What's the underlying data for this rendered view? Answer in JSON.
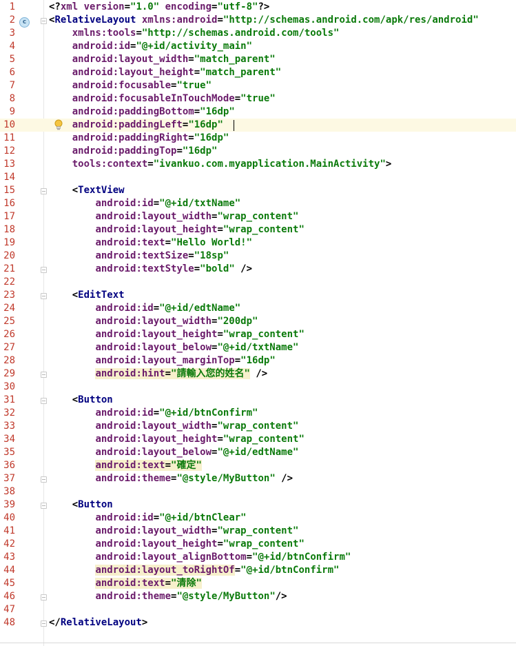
{
  "editor": {
    "current_line": 10,
    "lines": [
      {
        "n": "1",
        "segs": [
          [
            "punct",
            "<?"
          ],
          [
            "attr",
            "xml version"
          ],
          [
            "punct",
            "="
          ],
          [
            "val",
            "\"1.0\""
          ],
          [
            "attr",
            " encoding"
          ],
          [
            "punct",
            "="
          ],
          [
            "val",
            "\"utf-8\""
          ],
          [
            "punct",
            "?>"
          ]
        ]
      },
      {
        "n": "2",
        "segs": [
          [
            "punct",
            "<"
          ],
          [
            "tag",
            "RelativeLayout "
          ],
          [
            "attr",
            "xmlns:android"
          ],
          [
            "punct",
            "="
          ],
          [
            "val",
            "\"http://schemas.android.com/apk/res/android\""
          ]
        ]
      },
      {
        "n": "3",
        "segs": [
          [
            "punct",
            "    "
          ],
          [
            "attr",
            "xmlns:tools"
          ],
          [
            "punct",
            "="
          ],
          [
            "val",
            "\"http://schemas.android.com/tools\""
          ]
        ]
      },
      {
        "n": "4",
        "segs": [
          [
            "punct",
            "    "
          ],
          [
            "attr",
            "android:id"
          ],
          [
            "punct",
            "="
          ],
          [
            "val",
            "\"@+id/activity_main\""
          ]
        ]
      },
      {
        "n": "5",
        "segs": [
          [
            "punct",
            "    "
          ],
          [
            "attr",
            "android:layout_width"
          ],
          [
            "punct",
            "="
          ],
          [
            "val",
            "\"match_parent\""
          ]
        ]
      },
      {
        "n": "6",
        "segs": [
          [
            "punct",
            "    "
          ],
          [
            "attr",
            "android:layout_height"
          ],
          [
            "punct",
            "="
          ],
          [
            "val",
            "\"match_parent\""
          ]
        ]
      },
      {
        "n": "7",
        "segs": [
          [
            "punct",
            "    "
          ],
          [
            "attr",
            "android:focusable"
          ],
          [
            "punct",
            "="
          ],
          [
            "val",
            "\"true\""
          ]
        ]
      },
      {
        "n": "8",
        "segs": [
          [
            "punct",
            "    "
          ],
          [
            "attr",
            "android:focusableInTouchMode"
          ],
          [
            "punct",
            "="
          ],
          [
            "val",
            "\"true\""
          ]
        ]
      },
      {
        "n": "9",
        "segs": [
          [
            "punct",
            "    "
          ],
          [
            "attr",
            "android:paddingBottom"
          ],
          [
            "punct",
            "="
          ],
          [
            "val",
            "\"16dp\""
          ]
        ]
      },
      {
        "n": "10",
        "segs": [
          [
            "punct",
            "    "
          ],
          [
            "attr",
            "android:paddingLeft"
          ],
          [
            "punct",
            "="
          ],
          [
            "val",
            "\"16dp\""
          ]
        ]
      },
      {
        "n": "11",
        "segs": [
          [
            "punct",
            "    "
          ],
          [
            "attr",
            "android:paddingRight"
          ],
          [
            "punct",
            "="
          ],
          [
            "val",
            "\"16dp\""
          ]
        ]
      },
      {
        "n": "12",
        "segs": [
          [
            "punct",
            "    "
          ],
          [
            "attr",
            "android:paddingTop"
          ],
          [
            "punct",
            "="
          ],
          [
            "val",
            "\"16dp\""
          ]
        ]
      },
      {
        "n": "13",
        "segs": [
          [
            "punct",
            "    "
          ],
          [
            "attr",
            "tools:context"
          ],
          [
            "punct",
            "="
          ],
          [
            "val",
            "\"ivankuo.com.myapplication.MainActivity\""
          ],
          [
            "punct",
            ">"
          ]
        ]
      },
      {
        "n": "14",
        "segs": []
      },
      {
        "n": "15",
        "segs": [
          [
            "punct",
            "    <"
          ],
          [
            "tag",
            "TextView"
          ]
        ]
      },
      {
        "n": "16",
        "segs": [
          [
            "punct",
            "        "
          ],
          [
            "attr",
            "android:id"
          ],
          [
            "punct",
            "="
          ],
          [
            "val",
            "\"@+id/txtName\""
          ]
        ]
      },
      {
        "n": "17",
        "segs": [
          [
            "punct",
            "        "
          ],
          [
            "attr",
            "android:layout_width"
          ],
          [
            "punct",
            "="
          ],
          [
            "val",
            "\"wrap_content\""
          ]
        ]
      },
      {
        "n": "18",
        "segs": [
          [
            "punct",
            "        "
          ],
          [
            "attr",
            "android:layout_height"
          ],
          [
            "punct",
            "="
          ],
          [
            "val",
            "\"wrap_content\""
          ]
        ]
      },
      {
        "n": "19",
        "segs": [
          [
            "punct",
            "        "
          ],
          [
            "attr",
            "android:text"
          ],
          [
            "punct",
            "="
          ],
          [
            "val",
            "\"Hello World!\""
          ]
        ]
      },
      {
        "n": "20",
        "segs": [
          [
            "punct",
            "        "
          ],
          [
            "attr",
            "android:textSize"
          ],
          [
            "punct",
            "="
          ],
          [
            "val",
            "\"18sp\""
          ]
        ]
      },
      {
        "n": "21",
        "segs": [
          [
            "punct",
            "        "
          ],
          [
            "attr",
            "android:textStyle"
          ],
          [
            "punct",
            "="
          ],
          [
            "val",
            "\"bold\""
          ],
          [
            "punct",
            " />"
          ]
        ]
      },
      {
        "n": "22",
        "segs": []
      },
      {
        "n": "23",
        "segs": [
          [
            "punct",
            "    <"
          ],
          [
            "tag",
            "EditText"
          ]
        ]
      },
      {
        "n": "24",
        "segs": [
          [
            "punct",
            "        "
          ],
          [
            "attr",
            "android:id"
          ],
          [
            "punct",
            "="
          ],
          [
            "val",
            "\"@+id/edtName\""
          ]
        ]
      },
      {
        "n": "25",
        "segs": [
          [
            "punct",
            "        "
          ],
          [
            "attr",
            "android:layout_width"
          ],
          [
            "punct",
            "="
          ],
          [
            "val",
            "\"200dp\""
          ]
        ]
      },
      {
        "n": "26",
        "segs": [
          [
            "punct",
            "        "
          ],
          [
            "attr",
            "android:layout_height"
          ],
          [
            "punct",
            "="
          ],
          [
            "val",
            "\"wrap_content\""
          ]
        ]
      },
      {
        "n": "27",
        "segs": [
          [
            "punct",
            "        "
          ],
          [
            "attr",
            "android:layout_below"
          ],
          [
            "punct",
            "="
          ],
          [
            "val",
            "\"@+id/txtName\""
          ]
        ]
      },
      {
        "n": "28",
        "segs": [
          [
            "punct",
            "        "
          ],
          [
            "attr",
            "android:layout_marginTop"
          ],
          [
            "punct",
            "="
          ],
          [
            "val",
            "\"16dp\""
          ]
        ]
      },
      {
        "n": "29",
        "segs": [
          [
            "punct",
            "        "
          ],
          [
            "attr warn",
            "android:hint"
          ],
          [
            "punct warn",
            "="
          ],
          [
            "val warn",
            "\"請輸入您的姓名\""
          ],
          [
            "punct",
            " />"
          ]
        ]
      },
      {
        "n": "30",
        "segs": []
      },
      {
        "n": "31",
        "segs": [
          [
            "punct",
            "    <"
          ],
          [
            "tag",
            "Button"
          ]
        ]
      },
      {
        "n": "32",
        "segs": [
          [
            "punct",
            "        "
          ],
          [
            "attr",
            "android:id"
          ],
          [
            "punct",
            "="
          ],
          [
            "val",
            "\"@+id/btnConfirm\""
          ]
        ]
      },
      {
        "n": "33",
        "segs": [
          [
            "punct",
            "        "
          ],
          [
            "attr",
            "android:layout_width"
          ],
          [
            "punct",
            "="
          ],
          [
            "val",
            "\"wrap_content\""
          ]
        ]
      },
      {
        "n": "34",
        "segs": [
          [
            "punct",
            "        "
          ],
          [
            "attr",
            "android:layout_height"
          ],
          [
            "punct",
            "="
          ],
          [
            "val",
            "\"wrap_content\""
          ]
        ]
      },
      {
        "n": "35",
        "segs": [
          [
            "punct",
            "        "
          ],
          [
            "attr",
            "android:layout_below"
          ],
          [
            "punct",
            "="
          ],
          [
            "val",
            "\"@+id/edtName\""
          ]
        ]
      },
      {
        "n": "36",
        "segs": [
          [
            "punct",
            "        "
          ],
          [
            "attr warn",
            "android:text"
          ],
          [
            "punct warn",
            "="
          ],
          [
            "val warn",
            "\"確定\""
          ]
        ]
      },
      {
        "n": "37",
        "segs": [
          [
            "punct",
            "        "
          ],
          [
            "attr",
            "android:theme"
          ],
          [
            "punct",
            "="
          ],
          [
            "val",
            "\"@style/MyButton\""
          ],
          [
            "punct",
            " />"
          ]
        ]
      },
      {
        "n": "38",
        "segs": []
      },
      {
        "n": "39",
        "segs": [
          [
            "punct",
            "    <"
          ],
          [
            "tag",
            "Button"
          ]
        ]
      },
      {
        "n": "40",
        "segs": [
          [
            "punct",
            "        "
          ],
          [
            "attr",
            "android:id"
          ],
          [
            "punct",
            "="
          ],
          [
            "val",
            "\"@+id/btnClear\""
          ]
        ]
      },
      {
        "n": "41",
        "segs": [
          [
            "punct",
            "        "
          ],
          [
            "attr",
            "android:layout_width"
          ],
          [
            "punct",
            "="
          ],
          [
            "val",
            "\"wrap_content\""
          ]
        ]
      },
      {
        "n": "42",
        "segs": [
          [
            "punct",
            "        "
          ],
          [
            "attr",
            "android:layout_height"
          ],
          [
            "punct",
            "="
          ],
          [
            "val",
            "\"wrap_content\""
          ]
        ]
      },
      {
        "n": "43",
        "segs": [
          [
            "punct",
            "        "
          ],
          [
            "attr",
            "android:layout_alignBottom"
          ],
          [
            "punct",
            "="
          ],
          [
            "val",
            "\"@+id/btnConfirm\""
          ]
        ]
      },
      {
        "n": "44",
        "segs": [
          [
            "punct",
            "        "
          ],
          [
            "attr warn",
            "android:layout_toRightOf"
          ],
          [
            "punct",
            "="
          ],
          [
            "val",
            "\"@+id/btnConfirm\""
          ]
        ]
      },
      {
        "n": "45",
        "segs": [
          [
            "punct",
            "        "
          ],
          [
            "attr warn",
            "android:text"
          ],
          [
            "punct warn",
            "="
          ],
          [
            "val warn",
            "\"清除\""
          ]
        ]
      },
      {
        "n": "46",
        "segs": [
          [
            "punct",
            "        "
          ],
          [
            "attr",
            "android:theme"
          ],
          [
            "punct",
            "="
          ],
          [
            "val",
            "\"@style/MyButton\""
          ],
          [
            "punct",
            "/>"
          ]
        ]
      },
      {
        "n": "47",
        "segs": []
      },
      {
        "n": "48",
        "segs": [
          [
            "punct",
            "</"
          ],
          [
            "tag",
            "RelativeLayout"
          ],
          [
            "punct",
            ">"
          ]
        ]
      }
    ],
    "fold_markers": [
      2,
      15,
      21,
      23,
      29,
      31,
      37,
      39,
      46,
      48
    ],
    "gutter_icons": {
      "line_2": "class-c-icon",
      "line_10": "lightbulb-icon"
    },
    "colors": {
      "line_number": "#c0392b",
      "tag": "#000080",
      "attribute": "#6a1b6a",
      "value": "#0b7a0b",
      "current_line_bg": "#fdf9e3",
      "warning_bg": "#f7f0cc"
    }
  }
}
